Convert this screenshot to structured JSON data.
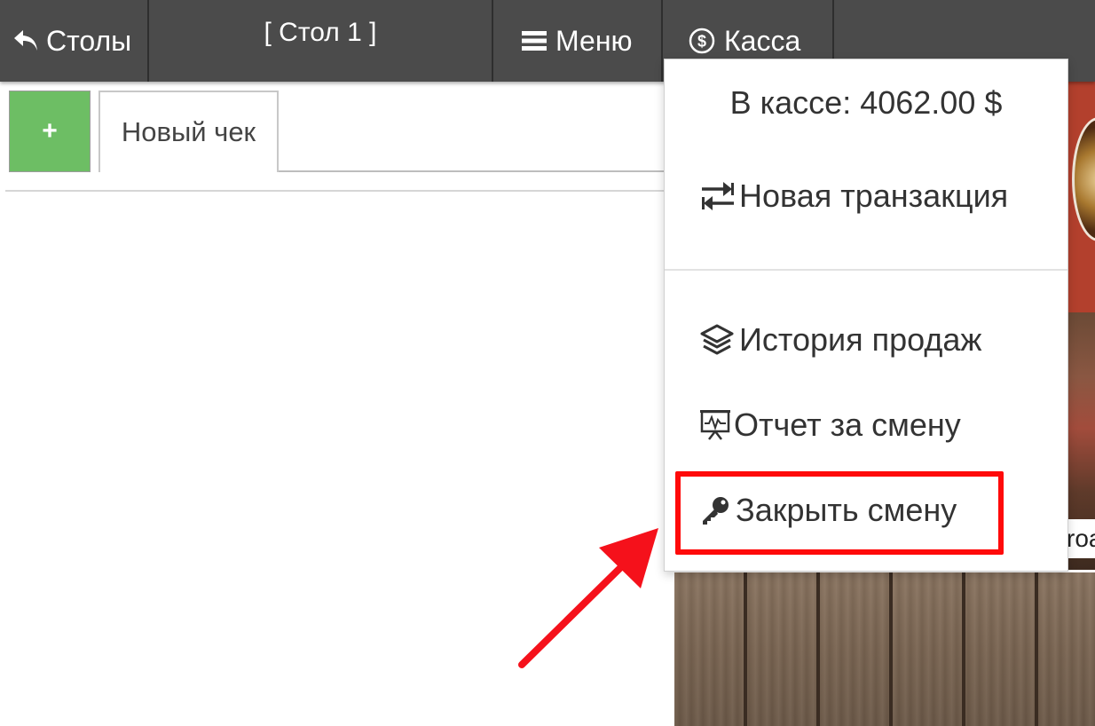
{
  "topbar": {
    "tables_label": "Столы",
    "table_title": "[ Стол 1 ]",
    "menu_label": "Меню",
    "cash_label": "Касса"
  },
  "tabs": {
    "add_label": "+",
    "items": [
      {
        "label": "Новый чек"
      }
    ]
  },
  "cash_dropdown": {
    "balance": "В кассе: 4062.00 $",
    "items": [
      {
        "label": "Новая транзакция",
        "icon": "exchange-icon"
      },
      {
        "label": "История продаж",
        "icon": "layers-icon"
      },
      {
        "label": "Отчет за смену",
        "icon": "chart-board-icon"
      },
      {
        "label": "Закрыть смену",
        "icon": "key-icon",
        "highlighted": true
      }
    ]
  },
  "background": {
    "meat_caption": "roa"
  },
  "colors": {
    "topbar": "#4b4b4b",
    "add_button": "#6dbe64",
    "highlight": "#ff0a0a"
  }
}
